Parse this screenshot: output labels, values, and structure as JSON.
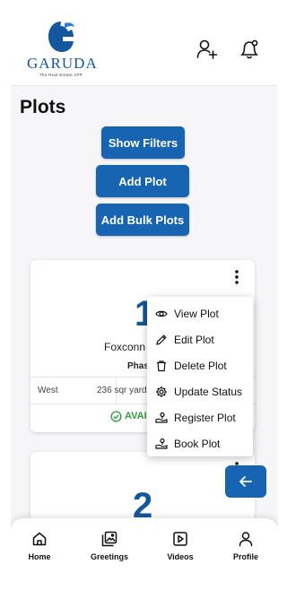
{
  "header": {
    "logo_text": "GARUDA",
    "logo_tagline": "The Real-Estate APP"
  },
  "page": {
    "title": "Plots"
  },
  "buttons": {
    "show_filters": "Show Filters",
    "add_plot": "Add Plot",
    "add_bulk_plots": "Add Bulk Plots"
  },
  "cards": [
    {
      "number": "1",
      "name": "Foxconn",
      "phase": "Phas",
      "facing": "West",
      "size": "236 sqr yard",
      "status": "AVAI"
    },
    {
      "number": "2"
    }
  ],
  "menu": {
    "items": [
      {
        "label": "View Plot",
        "icon": "eye-icon"
      },
      {
        "label": "Edit Plot",
        "icon": "pencil-icon"
      },
      {
        "label": "Delete Plot",
        "icon": "trash-icon"
      },
      {
        "label": "Update Status",
        "icon": "gear-icon"
      },
      {
        "label": "Register Plot",
        "icon": "register-icon"
      },
      {
        "label": "Book Plot",
        "icon": "book-icon"
      }
    ]
  },
  "bottom_nav": {
    "items": [
      {
        "label": "Home",
        "icon": "home-icon"
      },
      {
        "label": "Greetings",
        "icon": "gallery-icon"
      },
      {
        "label": "Videos",
        "icon": "video-icon"
      },
      {
        "label": "Profile",
        "icon": "profile-icon"
      }
    ]
  },
  "colors": {
    "primary": "#1764b2",
    "brand_text": "#13579e",
    "available": "#2e9e3e"
  }
}
